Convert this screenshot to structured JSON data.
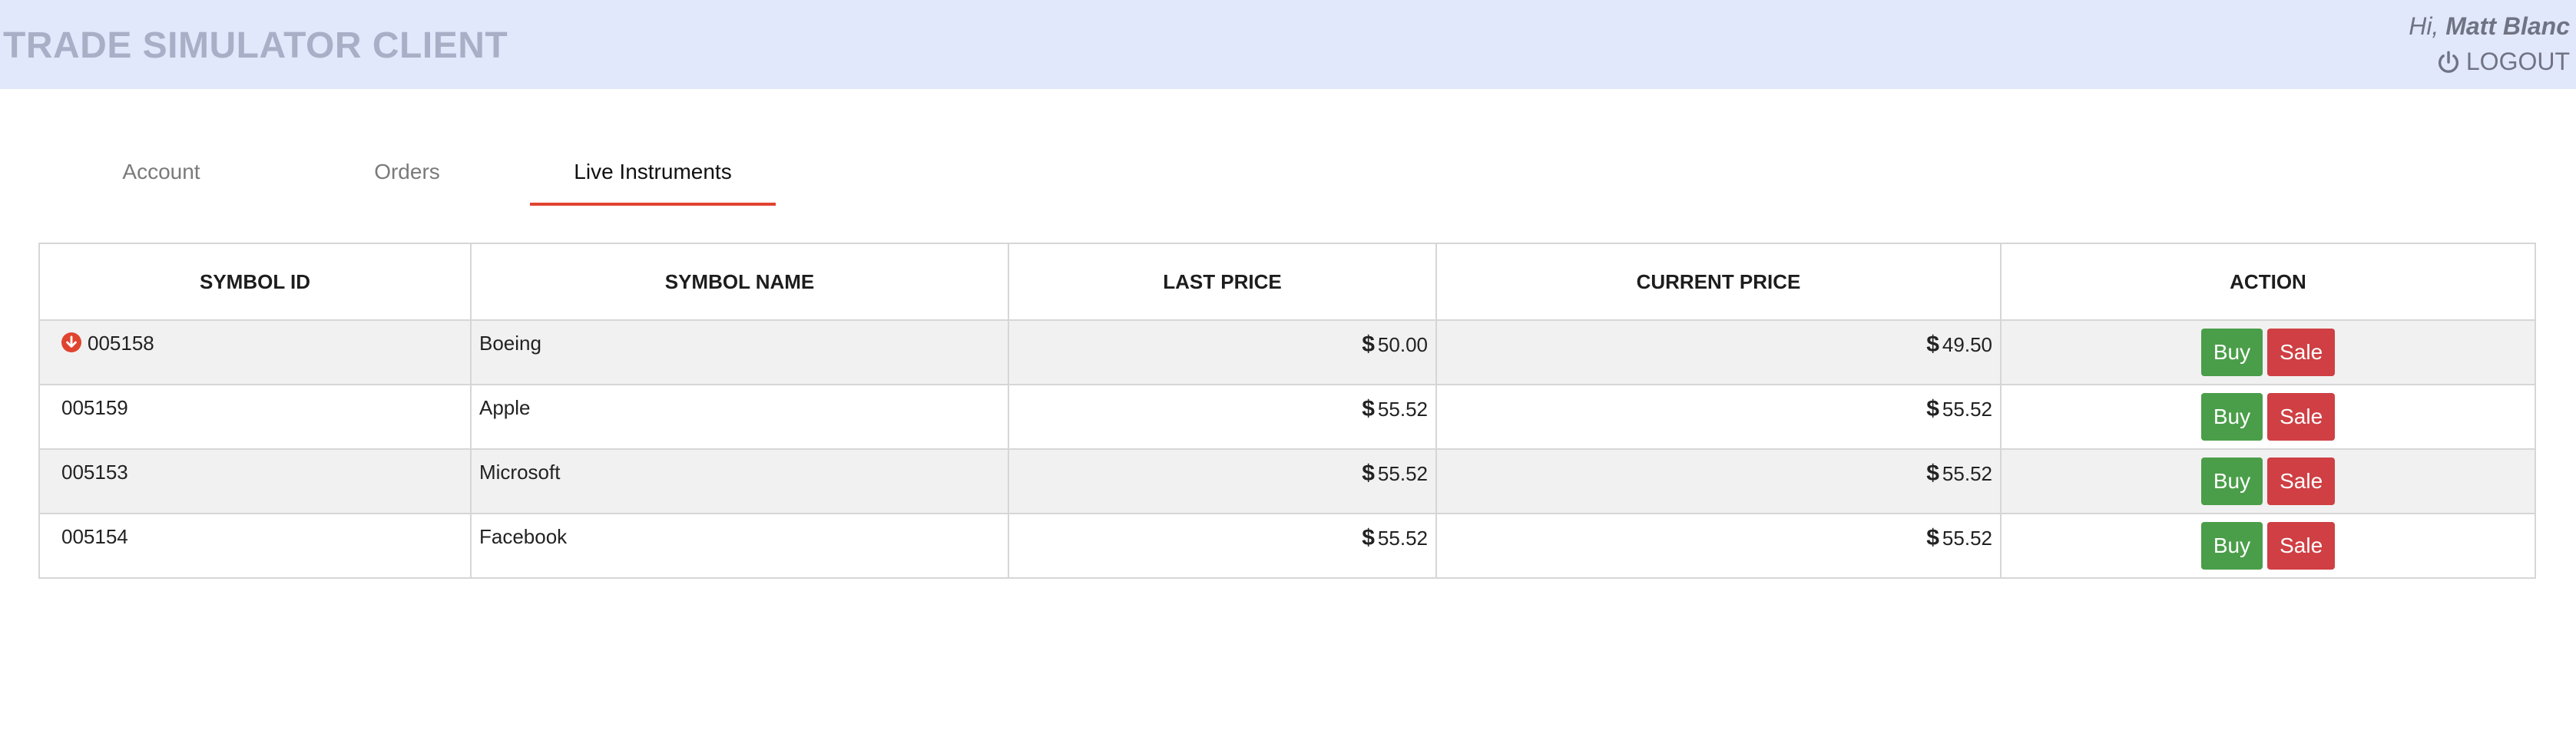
{
  "header": {
    "app_title": "TRADE SIMULATOR CLIENT",
    "greeting_prefix": "Hi,",
    "user_name": "Matt Blanc",
    "logout_label": "LOGOUT",
    "logout_icon": "power-icon"
  },
  "tabs": [
    {
      "label": "Account",
      "active": false
    },
    {
      "label": "Orders",
      "active": false
    },
    {
      "label": "Live Instruments",
      "active": true
    }
  ],
  "table": {
    "headers": [
      "SYMBOL ID",
      "SYMBOL NAME",
      "LAST PRICE",
      "CURRENT PRICE",
      "ACTION"
    ],
    "currency_symbol": "$",
    "rows": [
      {
        "symbol_id": "005158",
        "symbol_name": "Boeing",
        "last_price": "50.00",
        "current_price": "49.50",
        "trend_icon": "arrow-down-circle-icon"
      },
      {
        "symbol_id": "005159",
        "symbol_name": "Apple",
        "last_price": "55.52",
        "current_price": "55.52"
      },
      {
        "symbol_id": "005153",
        "symbol_name": "Microsoft",
        "last_price": "55.52",
        "current_price": "55.52"
      },
      {
        "symbol_id": "005154",
        "symbol_name": "Facebook",
        "last_price": "55.52",
        "current_price": "55.52"
      }
    ],
    "buy_label": "Buy",
    "sale_label": "Sale"
  },
  "colors": {
    "header_bg": "#e2e8fb",
    "active_tab_underline": "#e0442f",
    "buy_button": "#4a9e49",
    "sale_button": "#cf3f43",
    "down_indicator": "#e0442f"
  }
}
